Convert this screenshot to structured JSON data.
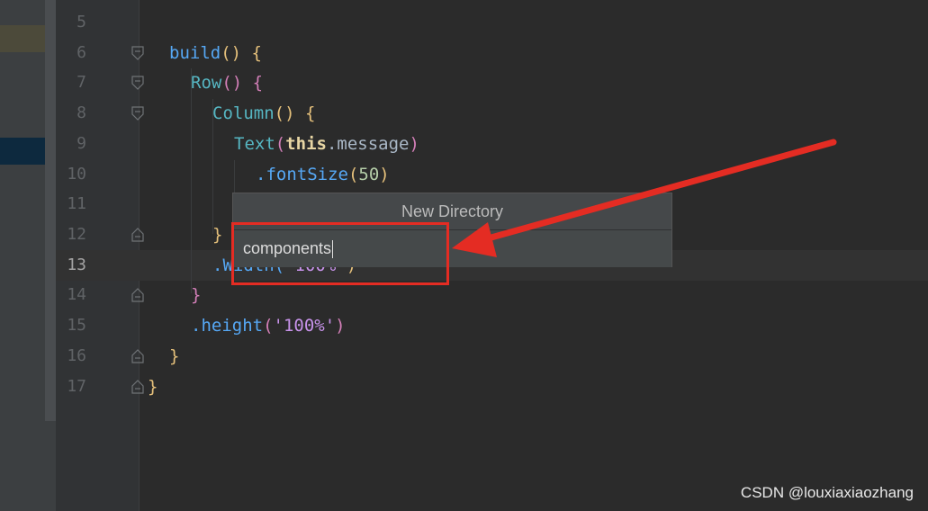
{
  "editor": {
    "lines": [
      {
        "no": "5"
      },
      {
        "no": "6"
      },
      {
        "no": "7"
      },
      {
        "no": "8"
      },
      {
        "no": "9"
      },
      {
        "no": "10"
      },
      {
        "no": "11"
      },
      {
        "no": "12"
      },
      {
        "no": "13"
      },
      {
        "no": "14"
      },
      {
        "no": "15"
      },
      {
        "no": "16"
      },
      {
        "no": "17"
      }
    ],
    "code": {
      "l6_fn": "build",
      "l6_rest": "() {",
      "l7_fn": "Row",
      "l7_rest": "() {",
      "l8_fn": "Column",
      "l8_rest": "() {",
      "l9_fn": "Text",
      "l9_open": "(",
      "l9_kw": "this",
      "l9_rest": ".message",
      "l9_close": ")",
      "l10_method": ".fontSize",
      "l10_open": "(",
      "l10_num": "50",
      "l10_close": ")",
      "l12_brace": "}",
      "l13_partial": ".Width(",
      "l13_arg": "'100%'",
      "l13_close": ")",
      "l14_brace": "}",
      "l15_method": ".height",
      "l15_open": "(",
      "l15_str": "'100%'",
      "l15_close": ")",
      "l16_brace": "}",
      "l17_brace": "}"
    }
  },
  "popup": {
    "title": "New Directory",
    "input_value": "components"
  },
  "annotation": {
    "color": "#e42c23"
  },
  "watermark": "CSDN @louxiaxiaozhang"
}
